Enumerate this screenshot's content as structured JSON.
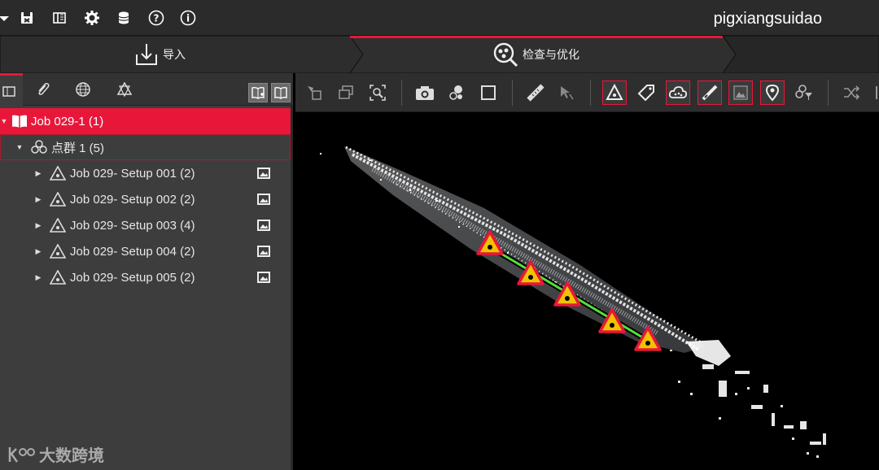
{
  "app": {
    "project_title": "pigxiangsuidao"
  },
  "topbar": {
    "icons": [
      "dropdown-icon",
      "save-icon",
      "panels-icon",
      "settings-icon",
      "database-icon",
      "help-icon",
      "info-icon"
    ]
  },
  "workflow": {
    "tabs": [
      {
        "label": "导入",
        "icon": "import-icon",
        "active": false
      },
      {
        "label": "检查与优化",
        "icon": "inspect-icon",
        "active": true
      }
    ],
    "accent": "#e8173a"
  },
  "left_panel": {
    "tabs": [
      "project-tab",
      "edit-tab",
      "globe-tab",
      "geo-tab"
    ],
    "tree": {
      "job": {
        "label": "Job 029-1 (1)"
      },
      "cloud": {
        "label": "点群 1 (5)"
      },
      "setups": [
        {
          "label": "Job 029- Setup 001 (2)"
        },
        {
          "label": "Job 029- Setup 002 (2)"
        },
        {
          "label": "Job 029- Setup 003 (4)"
        },
        {
          "label": "Job 029- Setup 004 (2)"
        },
        {
          "label": "Job 029- Setup 005 (2)"
        }
      ]
    }
  },
  "watermark": {
    "text": "大数跨境"
  }
}
